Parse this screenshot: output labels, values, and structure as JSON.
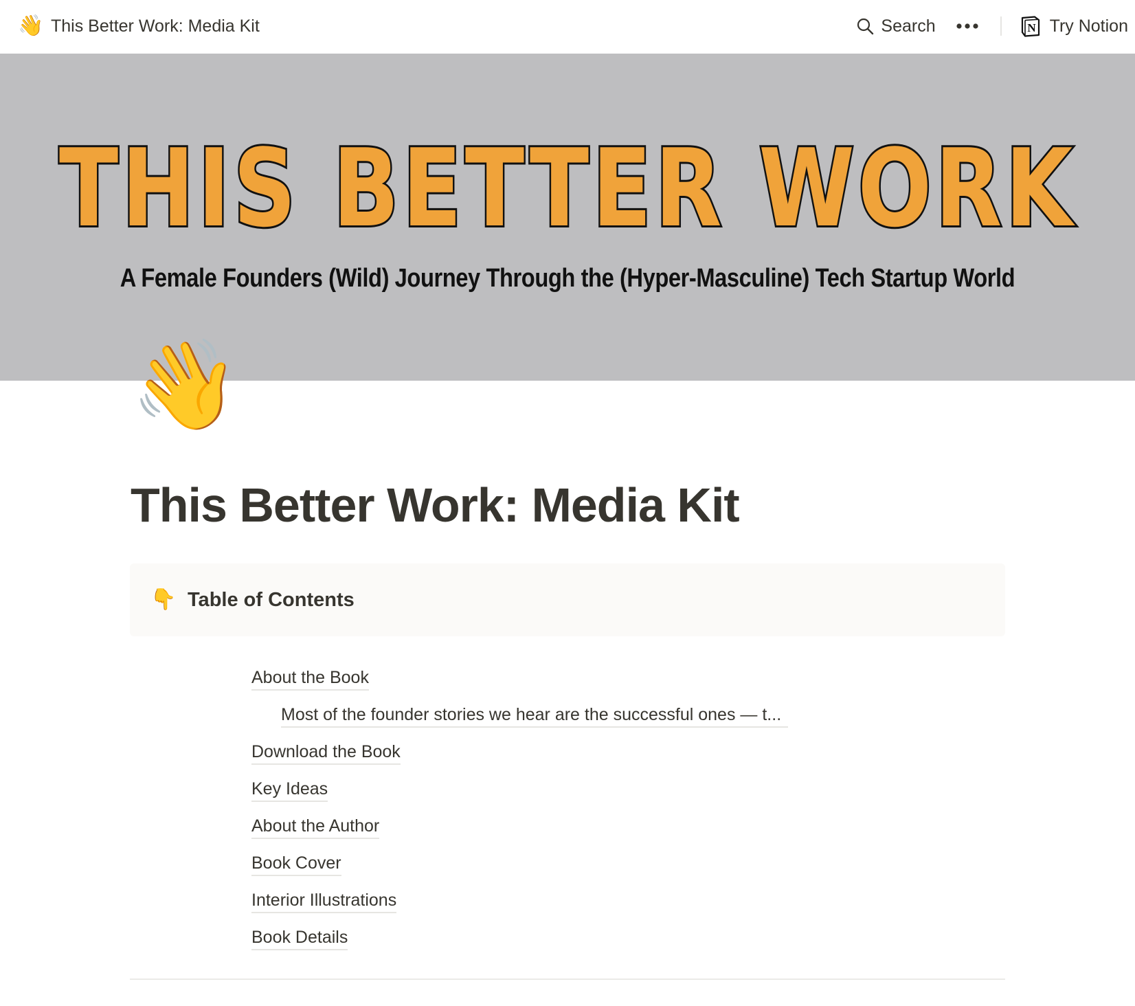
{
  "topbar": {
    "page_emoji": "👋",
    "page_title": "This Better Work: Media Kit",
    "search_label": "Search",
    "more_label": "•••",
    "try_notion_label": "Try Notion"
  },
  "banner": {
    "title": "THIS BETTER WORK",
    "subtitle": "A Female Founders (Wild) Journey Through the (Hyper-Masculine) Tech Startup World",
    "background_color": "#bebec0",
    "title_fill_color": "#f0a33a"
  },
  "page": {
    "icon": "👋",
    "title": "This Better Work: Media Kit"
  },
  "callout": {
    "icon": "👇",
    "text": "Table of Contents",
    "background_color": "#fbfaf8"
  },
  "toc": {
    "items": [
      {
        "label": "About the Book",
        "level": 1
      },
      {
        "label": "Most of the founder stories we hear are the successful ones — t...",
        "level": 2
      },
      {
        "label": "Download the Book",
        "level": 1
      },
      {
        "label": "Key Ideas",
        "level": 1
      },
      {
        "label": "About the Author",
        "level": 1
      },
      {
        "label": "Book Cover",
        "level": 1
      },
      {
        "label": "Interior Illustrations",
        "level": 1
      },
      {
        "label": "Book Details",
        "level": 1
      }
    ]
  }
}
